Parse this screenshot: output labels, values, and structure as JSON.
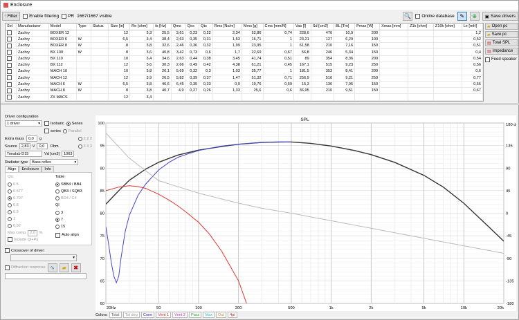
{
  "window": {
    "title": "Enclosure"
  },
  "toolbar": {
    "filter": "Filter",
    "enable_filtering": "Enable filtering",
    "pr": "PR",
    "visible": "1667/1667 visible",
    "online_db": "Online database",
    "save_drivers": "Save drivers"
  },
  "table": {
    "columns": [
      "Sel",
      "Manufacturer",
      "Model",
      "Type",
      "Status",
      "Size [in]",
      "Re [ohm]",
      "fs [Hz]",
      "Qms",
      "Qes",
      "Qts",
      "Rms [Ns/m]",
      "Mms [g]",
      "Cms [mm/N]",
      "Vas [l]",
      "Sd [cm2]",
      "BL [Tm]",
      "Pmax [W]",
      "Xmax [mm]",
      "Z1k [ohm]",
      "Z10k [ohm]",
      "Le [mH]"
    ],
    "rows": [
      [
        "",
        "Zachry",
        "BOXER 12",
        "",
        "",
        "12",
        "3,3",
        "25,5",
        "3,61",
        "0,23",
        "0,22",
        "2,34",
        "52,86",
        "0,74",
        "228,6",
        "470",
        "10,9",
        "200",
        "",
        "",
        "",
        "1,2"
      ],
      [
        "",
        "Zachry",
        "BOXER 6",
        "W",
        "",
        "6,5",
        "3,4",
        "38,4",
        "2,63",
        "0,35",
        "0,31",
        "1,53",
        "16,71",
        "1",
        "23,21",
        "127",
        "6,29",
        "100",
        "",
        "",
        "",
        "0,52"
      ],
      [
        "",
        "Zachry",
        "BOXER 8",
        "W",
        "",
        "8",
        "3,8",
        "32,6",
        "2,46",
        "0,36",
        "0,32",
        "1,99",
        "23,95",
        "1",
        "61,58",
        "210",
        "7,16",
        "150",
        "",
        "",
        "",
        "0,51"
      ],
      [
        "",
        "Zachry",
        "BX 100",
        "W",
        "",
        "8",
        "3,6",
        "40,8",
        "3,42",
        "0,73",
        "0,6",
        "1,7",
        "22,69",
        "0,67",
        "56,8",
        "246",
        "5,34",
        "150",
        "",
        "",
        "",
        "0,4"
      ],
      [
        "",
        "Zachry",
        "BX 110",
        "",
        "",
        "10",
        "3,4",
        "34,6",
        "2,63",
        "0,44",
        "0,38",
        "3,45",
        "41,74",
        "0,51",
        "89",
        "354",
        "8,36",
        "200",
        "",
        "",
        "",
        "0,54"
      ],
      [
        "",
        "Zachry",
        "BX 112",
        "",
        "",
        "12",
        "3,6",
        "30,3",
        "2,66",
        "0,49",
        "0,42",
        "4,38",
        "61,21",
        "0,45",
        "167,1",
        "515",
        "9,23",
        "250",
        "",
        "",
        "",
        "0,56"
      ],
      [
        "",
        "Zachry",
        "MACH 10",
        "",
        "",
        "10",
        "3,8",
        "26,1",
        "5,69",
        "0,32",
        "0,3",
        "1,03",
        "35,77",
        "1",
        "181,5",
        "353",
        "8,41",
        "200",
        "",
        "",
        "",
        "0,6"
      ],
      [
        "",
        "Zachry",
        "MACH 12",
        "",
        "",
        "12",
        "3,9",
        "26,5",
        "5,82",
        "0,39",
        "0,37",
        "1,47",
        "51,32",
        "0,71",
        "256,9",
        "510",
        "9,21",
        "250",
        "",
        "",
        "",
        "0,77"
      ],
      [
        "",
        "Zachry",
        "MACH 6",
        "W",
        "",
        "6,5",
        "3,8",
        "46,6",
        "6,45",
        "0,35",
        "0,33",
        "0,9",
        "19,76",
        "0,59",
        "15,3",
        "136",
        "7,95",
        "150",
        "",
        "",
        "",
        "0,56"
      ],
      [
        "",
        "Zachry",
        "MACH 8",
        "W",
        "",
        "8",
        "3,8",
        "40,7",
        "4,9",
        "0,27",
        "0,26",
        "1,33",
        "25,6",
        "0,6",
        "36,95",
        "210",
        "9,51",
        "150",
        "",
        "",
        "",
        "0,67"
      ],
      [
        "",
        "Zachry",
        "ZX MACS",
        "",
        "",
        "12",
        "3,4",
        "",
        "",
        "",
        "",
        "",
        "",
        "",
        "",
        "",
        "",
        "",
        "",
        "",
        "",
        ""
      ]
    ]
  },
  "right_buttons": {
    "open": "Open pc",
    "save": "Save pc",
    "total_spl": "Total SPL",
    "impedance": "Impedance",
    "feed_speaker": "Feed speaker"
  },
  "left": {
    "driver_config": "Driver configuration",
    "driver_count": "1 driver",
    "isobaric": "Isobaric",
    "series_radio": "Series",
    "series_chk": "series",
    "parallel": "Parallel",
    "opt_222": "2 2 2",
    "opt_333": "3 3 3",
    "extra_mass": "Extra mass",
    "extra_mass_val": "0,0",
    "g": "g",
    "source": "Source",
    "source_v": "2,83",
    "v": "V",
    "source_ohm": "0,0",
    "ohm": "Ohm",
    "tonalab": "Tonalab D15",
    "vd": "Vd [cm3]",
    "vd_val": "1063",
    "radiator_type": "Radiator type",
    "radiator_val": "Bass reflex",
    "tabs": [
      "Align",
      "Enclosure",
      "Info"
    ],
    "qtc": "Qtc",
    "qtc_opts": [
      "0.5",
      "0.577",
      "0.707",
      "0.8",
      "0.9",
      "1",
      "0,92"
    ],
    "table_lbl": "Table",
    "table_opts": [
      "SBB4 / BB4",
      "QB3 / SQB3",
      "BD4 / C4"
    ],
    "ql": "Ql",
    "ql_opts": [
      "3",
      "7",
      "15"
    ],
    "max_comp": "Max comp.",
    "max_comp_val": "2,0",
    "pct": "%",
    "include": "Include Qi+Pa",
    "auto_align": "Auto align",
    "crossover": "Crossover of driver:",
    "diffraction": "Diffraction response"
  },
  "chart_data": {
    "type": "line",
    "title": "SPL",
    "xscale": "log",
    "xlim": [
      20,
      20000
    ],
    "ylim": [
      60,
      100
    ],
    "y2lim": [
      -180,
      180
    ],
    "x_ticks": [
      "20Hz",
      "50",
      "100",
      "200",
      "500",
      "1k",
      "2k",
      "5k",
      "10k",
      "20k"
    ],
    "x_tick_vals": [
      20,
      50,
      100,
      200,
      500,
      1000,
      2000,
      5000,
      10000,
      20000
    ],
    "y_ticks": [
      60,
      65,
      70,
      75,
      80,
      85,
      90,
      95,
      100
    ],
    "y2_ticks": [
      "-180",
      "-135",
      "-90",
      "-45",
      "0",
      "45",
      "90",
      "135",
      "180 deg"
    ],
    "y2_tick_vals": [
      -180,
      -135,
      -90,
      -45,
      0,
      45,
      90,
      135,
      180
    ],
    "grid": true,
    "series": [
      {
        "color": "#333333",
        "x": [
          20,
          25,
          30,
          40,
          50,
          70,
          100,
          150,
          200,
          300,
          400,
          500,
          700,
          1000,
          1500,
          2000,
          3000,
          5000,
          7000,
          10000,
          15000,
          20000
        ],
        "y": [
          82,
          85,
          87.3,
          89.8,
          91.3,
          92.9,
          94.0,
          94.8,
          95.3,
          95.7,
          95.8,
          95.8,
          95.5,
          94.9,
          93.9,
          93.0,
          91.3,
          88.4,
          85.8,
          82.2,
          77.3,
          73.8
        ]
      },
      {
        "color": "#4444cc",
        "x": [
          20,
          21,
          22,
          23,
          24,
          25,
          26,
          28,
          30,
          35,
          40,
          50,
          60,
          70,
          80,
          100,
          150,
          200,
          300,
          500
        ],
        "y": [
          77,
          73,
          69,
          66,
          64.6,
          66,
          70,
          76,
          79.5,
          84,
          86.5,
          89.6,
          91.3,
          92.4,
          93.0,
          93.9,
          94.9,
          95.3,
          95.7,
          95.8
        ]
      },
      {
        "color": "#dd3333",
        "x": [
          20,
          25,
          30,
          35,
          40,
          50,
          60,
          70,
          80,
          100,
          120,
          150,
          200,
          230
        ],
        "y": [
          85,
          85.8,
          86.1,
          85.9,
          85.5,
          84.2,
          82.9,
          81.6,
          80.3,
          78,
          75.5,
          71.5,
          65,
          60
        ]
      },
      {
        "color": "#bbbbbb",
        "x": [
          20,
          30,
          50,
          100,
          200,
          300,
          500,
          1000,
          2000,
          5000,
          10000,
          20000
        ],
        "y": [
          160,
          110,
          65,
          40,
          20,
          10,
          0,
          -15,
          -30,
          -50,
          -65,
          -80
        ]
      }
    ],
    "legend_label": "Colors:",
    "legend": [
      {
        "label": "Total",
        "color": "#555555"
      },
      {
        "label": "Tot deg",
        "color": "#999999"
      },
      {
        "label": "Cone",
        "color": "#2222cc"
      },
      {
        "label": "Vent 1",
        "color": "#cc2222"
      },
      {
        "label": "Vent 2",
        "color": "#cc22cc"
      },
      {
        "label": "Pass",
        "color": "#22aa22"
      },
      {
        "label": "Max",
        "color": "#22bbbb"
      },
      {
        "label": "Out",
        "color": "#cc8822"
      },
      {
        "label": "4pi",
        "color": "#aa2222"
      }
    ]
  }
}
